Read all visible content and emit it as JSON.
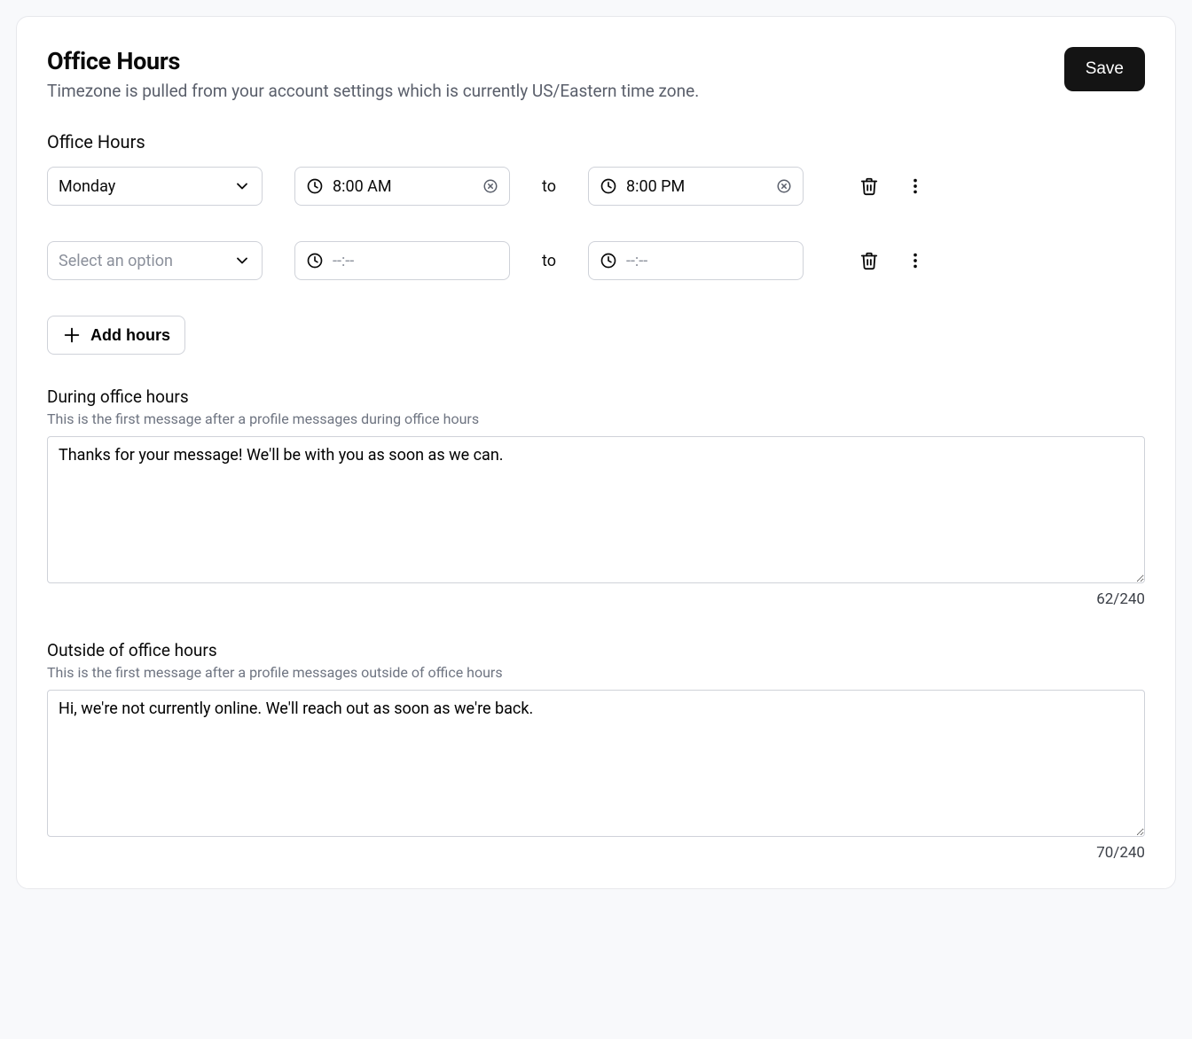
{
  "header": {
    "title": "Office Hours",
    "subtitle": "Timezone is pulled from your account settings which is currently US/Eastern time zone.",
    "save_label": "Save"
  },
  "hours": {
    "section_label": "Office Hours",
    "to_label": "to",
    "add_hours_label": "Add hours",
    "rows": [
      {
        "day": "Monday",
        "day_placeholder": "Select an option",
        "has_day": true,
        "start": "8:00 AM",
        "start_placeholder": "--:--",
        "has_start": true,
        "end": "8:00 PM",
        "end_placeholder": "--:--",
        "has_end": true
      },
      {
        "day": "",
        "day_placeholder": "Select an option",
        "has_day": false,
        "start": "",
        "start_placeholder": "--:--",
        "has_start": false,
        "end": "",
        "end_placeholder": "--:--",
        "has_end": false
      }
    ]
  },
  "during": {
    "label": "During office hours",
    "help": "This is the first message after a profile messages during office hours",
    "value": "Thanks for your message! We'll be with you as soon as we can.",
    "count": "62/240"
  },
  "outside": {
    "label": "Outside of office hours",
    "help": "This is the first message after a profile messages outside of office hours",
    "value": "Hi, we're not currently online. We'll reach out as soon as we're back.",
    "count": "70/240"
  }
}
